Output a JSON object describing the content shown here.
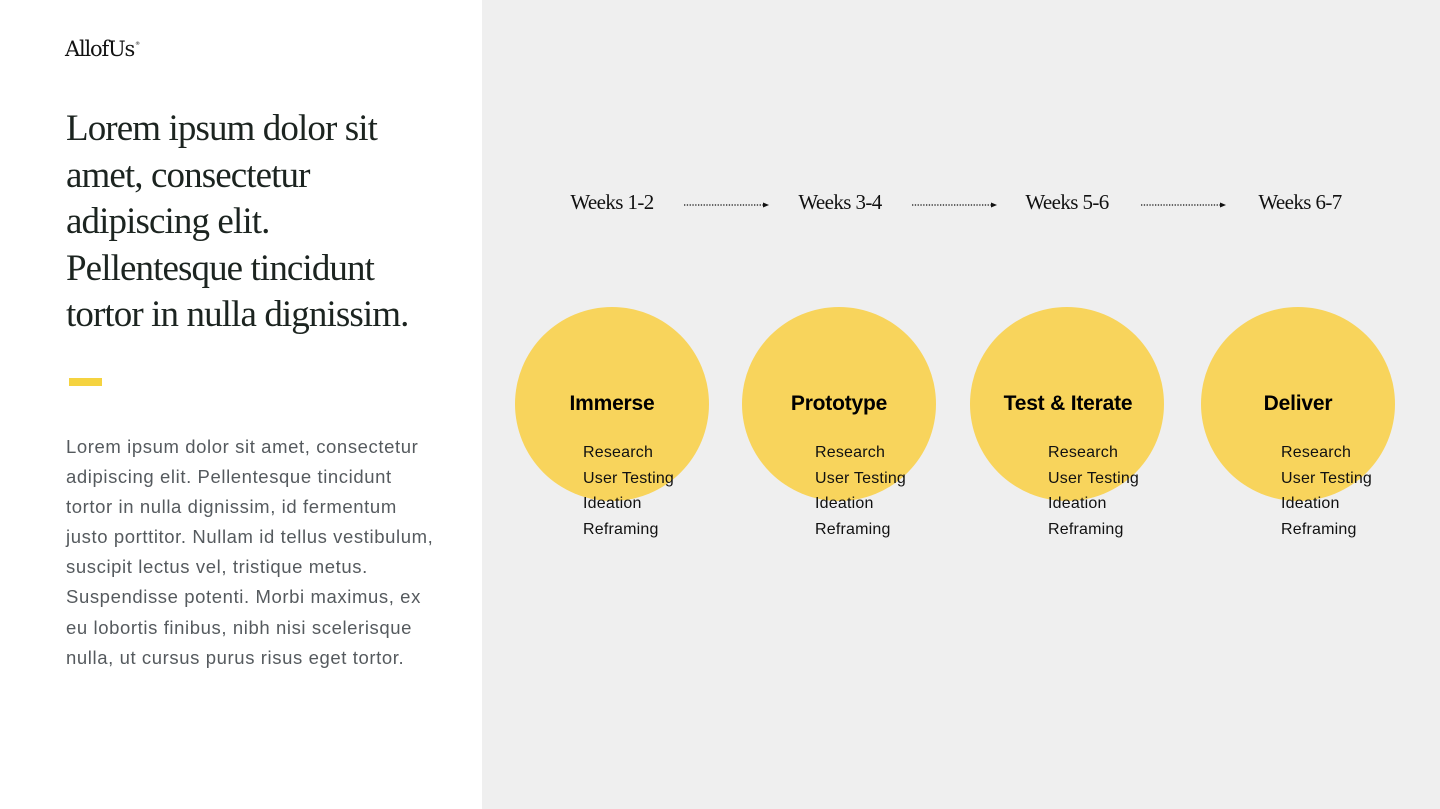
{
  "brand": {
    "logo_text": "AllofUs",
    "logo_mark": "®"
  },
  "intro": {
    "headline": "Lorem ipsum dolor sit amet, consectetur adipiscing elit. Pellentesque tincidunt tortor in nulla dignissim.",
    "body": "Lorem ipsum dolor sit amet, consectetur adipiscing elit. Pellentesque tincidunt tortor in nulla dignissim, id fermentum justo porttitor. Nullam id tellus vestibulum, suscipit lectus vel, tristique metus. Suspendisse potenti. Morbi maximus, ex eu lobortis finibus, nibh nisi scelerisque nulla, ut cursus purus risus eget tortor."
  },
  "colors": {
    "accent": "#f5d340",
    "circle": "#f8d45c",
    "panel_bg": "#efefef"
  },
  "timeline": {
    "weeks": [
      "Weeks 1-2",
      "Weeks 3-4",
      "Weeks 5-6",
      "Weeks 6-7"
    ],
    "stages": [
      {
        "title": "Immerse",
        "items": [
          "Research",
          "User Testing",
          "Ideation",
          "Reframing"
        ]
      },
      {
        "title": "Prototype",
        "items": [
          "Research",
          "User Testing",
          "Ideation",
          "Reframing"
        ]
      },
      {
        "title": "Test & Iterate",
        "items": [
          "Research",
          "User Testing",
          "Ideation",
          "Reframing"
        ]
      },
      {
        "title": "Deliver",
        "items": [
          "Research",
          "User Testing",
          "Ideation",
          "Reframing"
        ]
      }
    ]
  }
}
